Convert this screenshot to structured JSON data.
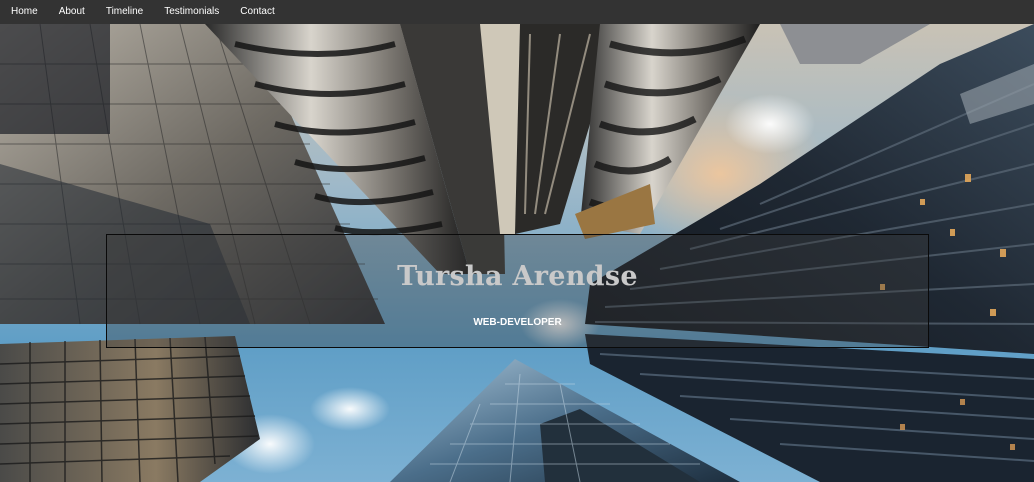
{
  "nav": {
    "items": [
      {
        "label": "Home"
      },
      {
        "label": "About"
      },
      {
        "label": "Timeline"
      },
      {
        "label": "Testimonials"
      },
      {
        "label": "Contact"
      }
    ]
  },
  "hero": {
    "name": "Tursha Arendse",
    "role": "WEB-DEVELOPER"
  },
  "colors": {
    "navbar_bg": "#333333",
    "nav_text": "#ffffff",
    "sky": "#6fa9cf"
  }
}
